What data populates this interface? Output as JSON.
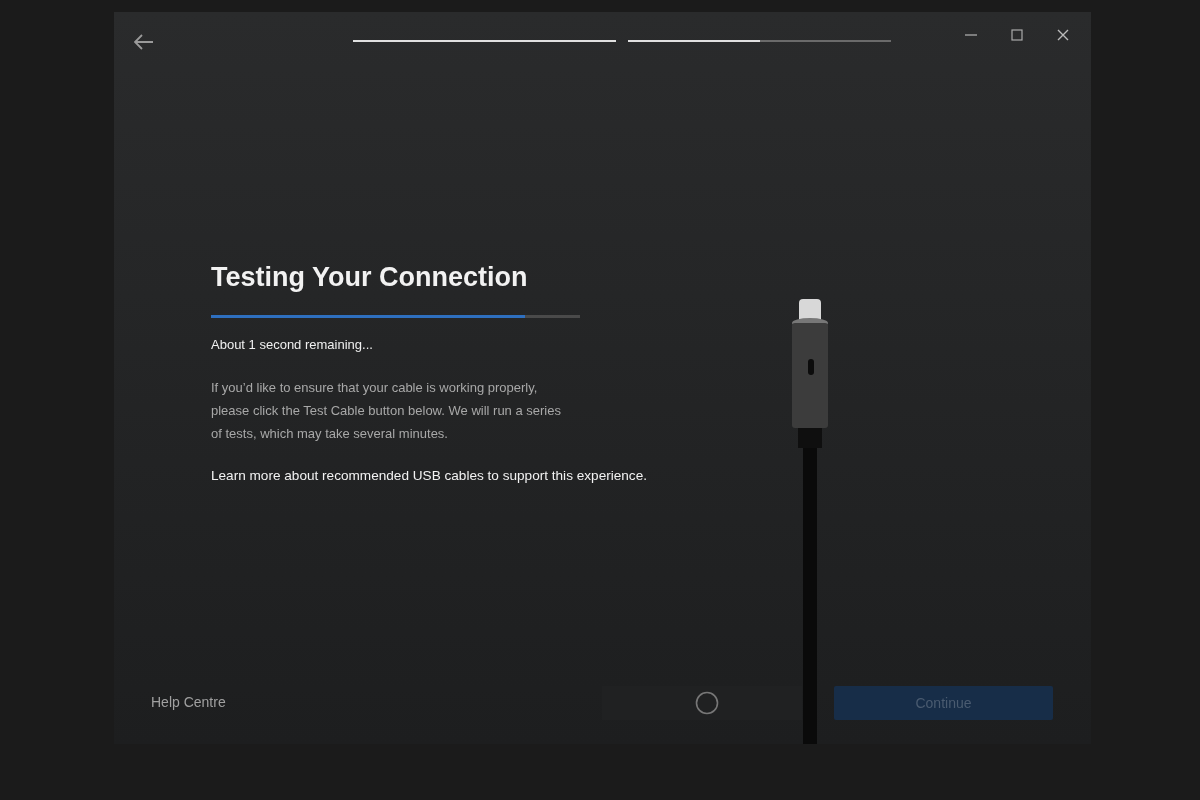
{
  "window": {
    "steps": [
      {
        "level": 1
      },
      {
        "level": 0.5
      }
    ]
  },
  "content": {
    "title": "Testing Your Connection",
    "progress": {
      "level": 0.85
    },
    "status": "About 1 second remaining...",
    "description": "If you’d like to ensure that your cable is working properly, please click the Test Cable button below. We will run a series of tests, which may take several minutes.",
    "link": "Learn more about recommended USB cables to support this experience."
  },
  "footer": {
    "help_link": "Help Centre",
    "test_button": {
      "busy": true,
      "disabled": true
    },
    "continue_button": {
      "label": "Continue",
      "disabled": true
    }
  }
}
